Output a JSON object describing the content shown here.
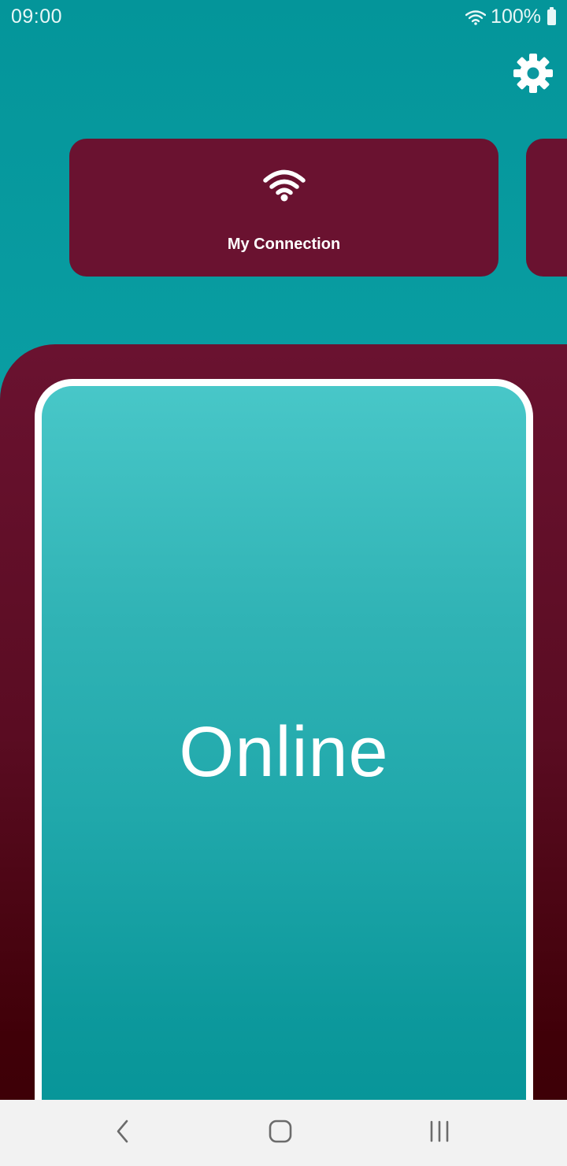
{
  "status_bar": {
    "time": "09:00",
    "battery": "100%",
    "icons": [
      "wifi-icon",
      "battery-icon"
    ]
  },
  "header": {
    "settings_icon": "gear-icon"
  },
  "cards": [
    {
      "label": "My Connection",
      "icon": "wifi-icon"
    }
  ],
  "status_panel": {
    "status": "Online"
  },
  "nav_bar": {
    "buttons": [
      "back-icon",
      "home-icon",
      "recents-icon"
    ]
  },
  "colors": {
    "teal": "#0a9ea3",
    "maroon": "#6a1230",
    "white": "#ffffff"
  }
}
